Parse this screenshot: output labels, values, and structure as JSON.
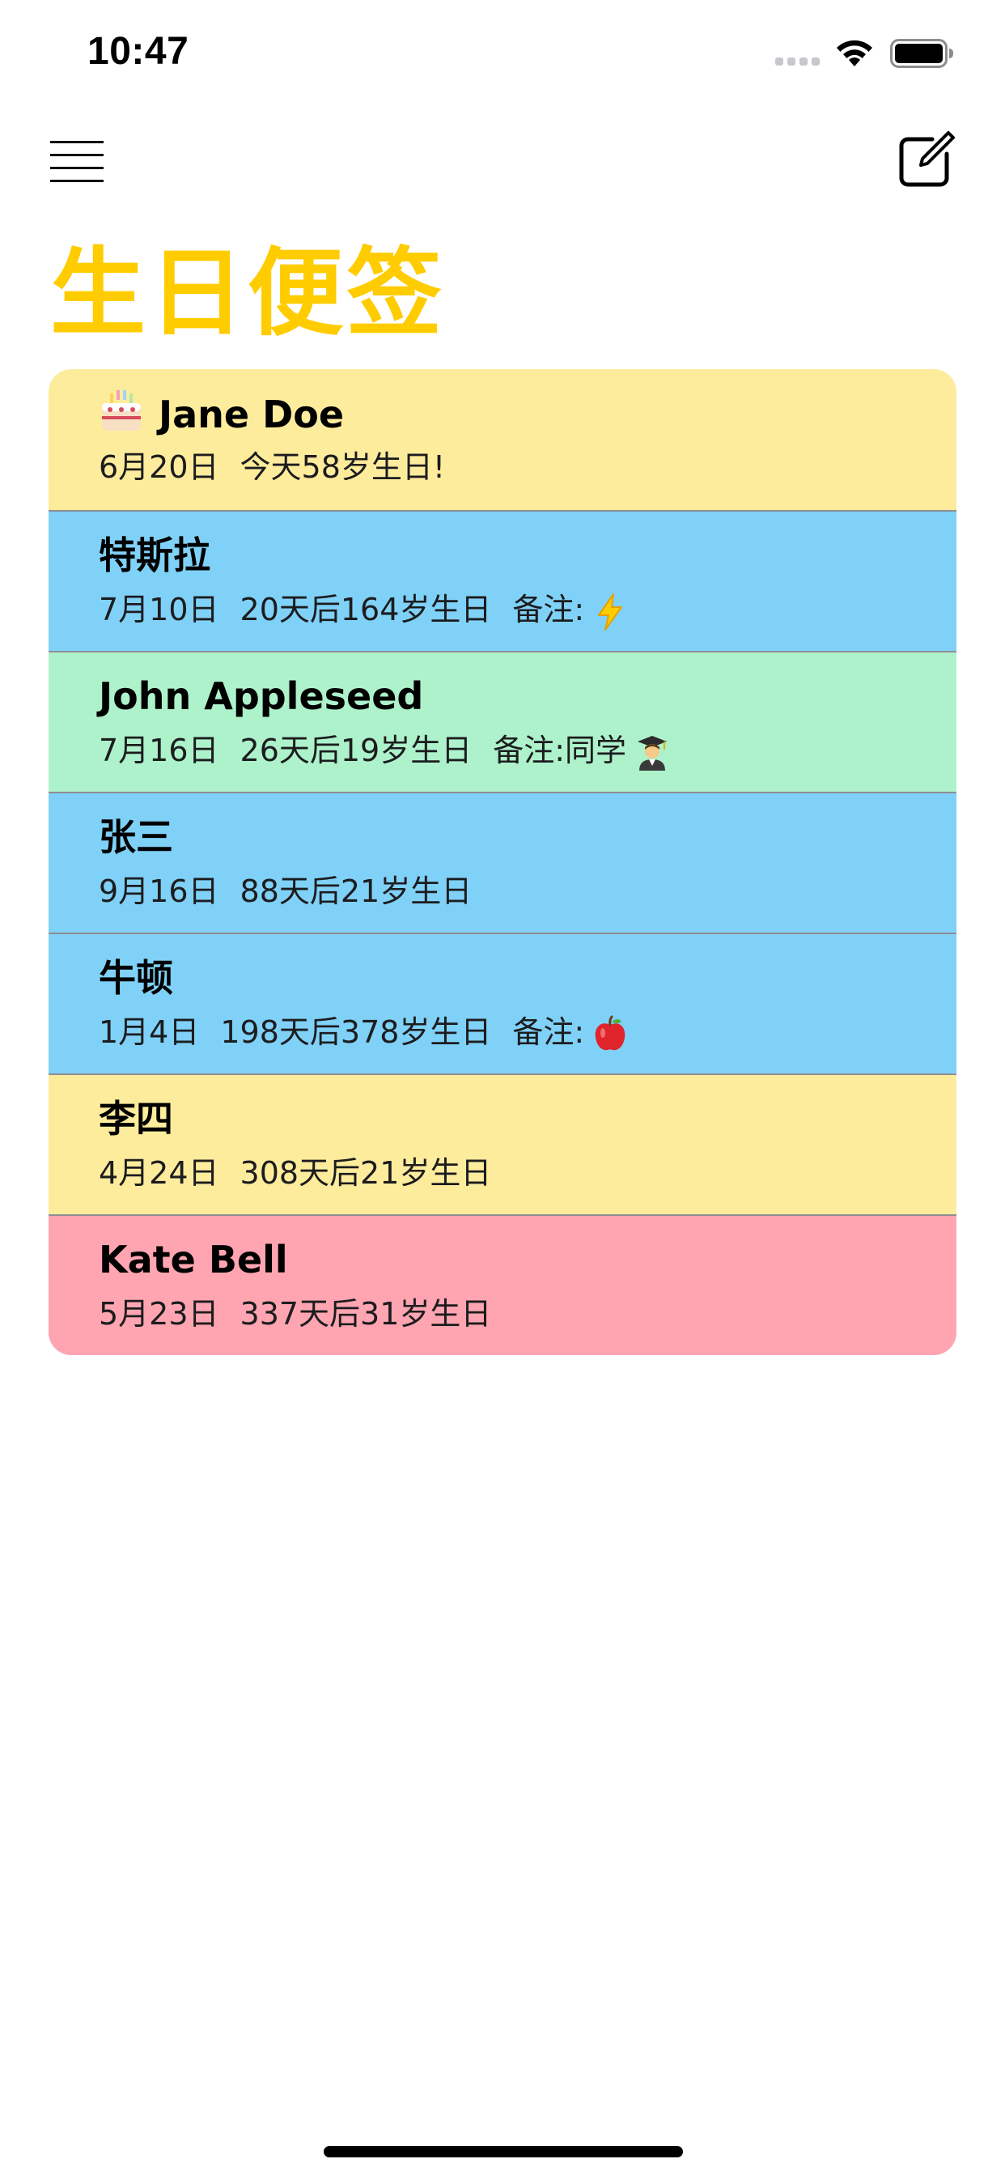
{
  "status_bar": {
    "time": "10:47"
  },
  "header": {
    "title": "生日便签",
    "title_color": "#FFCC00"
  },
  "colors": {
    "yellow": "#FEEC9D",
    "blue": "#80D1F7",
    "green": "#ADF2CB",
    "pink": "#FEA5B1"
  },
  "list": [
    {
      "name": "Jane Doe",
      "name_icon": "birthday-cake-icon",
      "date": "6月20日",
      "countdown": "今天58岁生日!",
      "note": "",
      "note_icon": "",
      "color": "#FEEC9D"
    },
    {
      "name": "特斯拉",
      "date": "7月10日",
      "countdown": "20天后164岁生日",
      "note": "备注:",
      "note_icon": "lightning-icon",
      "color": "#80D1F7"
    },
    {
      "name": "John Appleseed",
      "date": "7月16日",
      "countdown": "26天后19岁生日",
      "note": "备注:同学",
      "note_icon": "graduate-icon",
      "color": "#ADF2CB"
    },
    {
      "name": "张三",
      "date": "9月16日",
      "countdown": "88天后21岁生日",
      "note": "",
      "note_icon": "",
      "color": "#80D1F7"
    },
    {
      "name": "牛顿",
      "date": "1月4日",
      "countdown": "198天后378岁生日",
      "note": "备注:",
      "note_icon": "apple-icon",
      "color": "#80D1F7"
    },
    {
      "name": "李四",
      "date": "4月24日",
      "countdown": "308天后21岁生日",
      "note": "",
      "note_icon": "",
      "color": "#FEEC9D"
    },
    {
      "name": "Kate Bell",
      "date": "5月23日",
      "countdown": "337天后31岁生日",
      "note": "",
      "note_icon": "",
      "color": "#FEA5B1"
    }
  ],
  "icons": {
    "menu": "hamburger-menu-icon",
    "compose": "compose-icon",
    "wifi": "wifi-icon",
    "battery": "battery-icon",
    "signal": "signal-icon"
  }
}
